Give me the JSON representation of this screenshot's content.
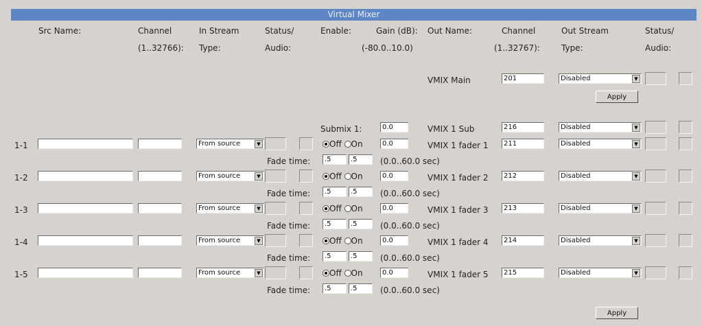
{
  "title": "Virtual Mixer",
  "headers": {
    "src_name": "Src Name:",
    "channel_in": [
      "Channel",
      "(1..32766):"
    ],
    "in_stream": [
      "In Stream",
      "Type:"
    ],
    "status_in": [
      "Status/",
      "Audio:"
    ],
    "enable": "Enable:",
    "gain": [
      "Gain (dB):",
      "(-80.0..10.0)"
    ],
    "out_name": "Out Name:",
    "channel_out": [
      "Channel",
      "(1..32767):"
    ],
    "out_stream": [
      "Out Stream",
      "Type:"
    ],
    "status_out": [
      "Status/",
      "Audio:"
    ]
  },
  "main": {
    "name": "VMIX Main",
    "channel": "201",
    "stream": "Disabled",
    "apply": "Apply"
  },
  "submix": {
    "label": "Submix 1:",
    "gain": "0.0",
    "name": "VMIX 1 Sub",
    "channel": "216",
    "stream": "Disabled"
  },
  "rows": [
    {
      "id": "1-1",
      "src": "",
      "chan": "",
      "in_type": "From source",
      "off": "Off",
      "on": "On",
      "gain": "0.0",
      "out_name": "VMIX 1 fader 1",
      "out_chan": "211",
      "out_type": "Disabled",
      "fade_label": "Fade time:",
      "fade_a": ".5",
      "fade_b": ".5",
      "fade_range": "(0.0..60.0 sec)"
    },
    {
      "id": "1-2",
      "src": "",
      "chan": "",
      "in_type": "From source",
      "off": "Off",
      "on": "On",
      "gain": "0.0",
      "out_name": "VMIX 1 fader 2",
      "out_chan": "212",
      "out_type": "Disabled",
      "fade_label": "Fade time:",
      "fade_a": ".5",
      "fade_b": ".5",
      "fade_range": "(0.0..60.0 sec)"
    },
    {
      "id": "1-3",
      "src": "",
      "chan": "",
      "in_type": "From source",
      "off": "Off",
      "on": "On",
      "gain": "0.0",
      "out_name": "VMIX 1 fader 3",
      "out_chan": "213",
      "out_type": "Disabled",
      "fade_label": "Fade time:",
      "fade_a": ".5",
      "fade_b": ".5",
      "fade_range": "(0.0..60.0 sec)"
    },
    {
      "id": "1-4",
      "src": "",
      "chan": "",
      "in_type": "From source",
      "off": "Off",
      "on": "On",
      "gain": "0.0",
      "out_name": "VMIX 1 fader 4",
      "out_chan": "214",
      "out_type": "Disabled",
      "fade_label": "Fade time:",
      "fade_a": ".5",
      "fade_b": ".5",
      "fade_range": "(0.0..60.0 sec)"
    },
    {
      "id": "1-5",
      "src": "",
      "chan": "",
      "in_type": "From source",
      "off": "Off",
      "on": "On",
      "gain": "0.0",
      "out_name": "VMIX 1 fader 5",
      "out_chan": "215",
      "out_type": "Disabled",
      "fade_label": "Fade time:",
      "fade_a": ".5",
      "fade_b": ".5",
      "fade_range": "(0.0..60.0 sec)"
    }
  ],
  "bottom_apply": "Apply"
}
